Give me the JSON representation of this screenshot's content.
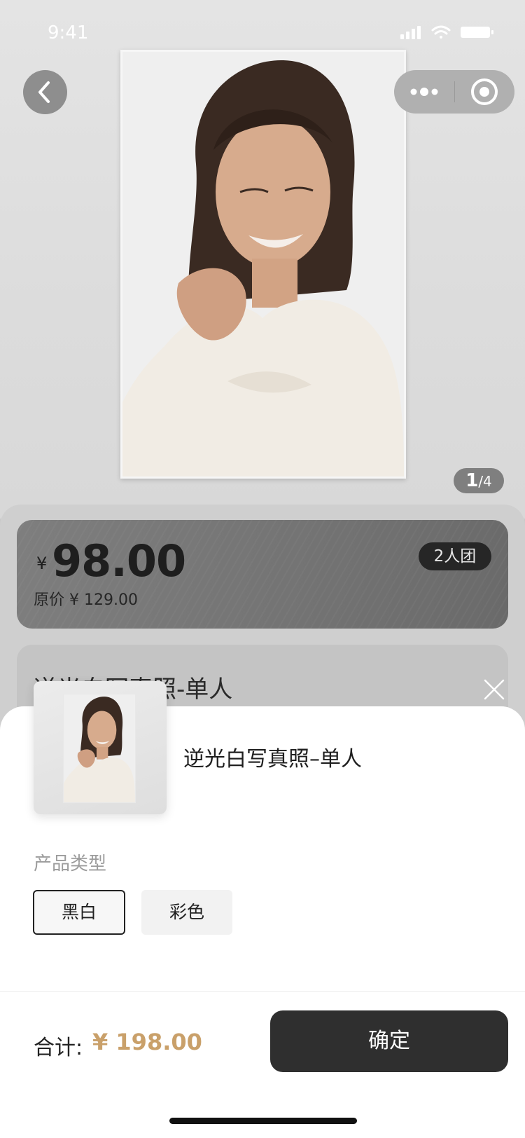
{
  "status_bar": {
    "time": "9:41"
  },
  "header": {
    "back_icon": "chevron-left-icon",
    "more_icon": "more-dots-icon",
    "target_icon": "target-icon"
  },
  "gallery": {
    "current": "1",
    "total": "/4"
  },
  "price_card": {
    "currency": "¥",
    "price": "98.00",
    "original_price": "原价 ¥ 129.00",
    "group_badge": "2人团"
  },
  "background_product": {
    "title": "逆光白写真照-单人"
  },
  "sheet": {
    "close_icon": "close-icon",
    "product_title": "逆光白写真照–单人",
    "type_label": "产品类型",
    "options": [
      "黑白",
      "彩色"
    ],
    "selected_option": "黑白",
    "total_label": "合计:",
    "total_value": "¥ 198.00",
    "confirm_label": "确定"
  },
  "colors": {
    "accent_price": "#c9a06a",
    "confirm_bg": "#2f2f2f",
    "overlay_gray": "#cfcfcf"
  }
}
